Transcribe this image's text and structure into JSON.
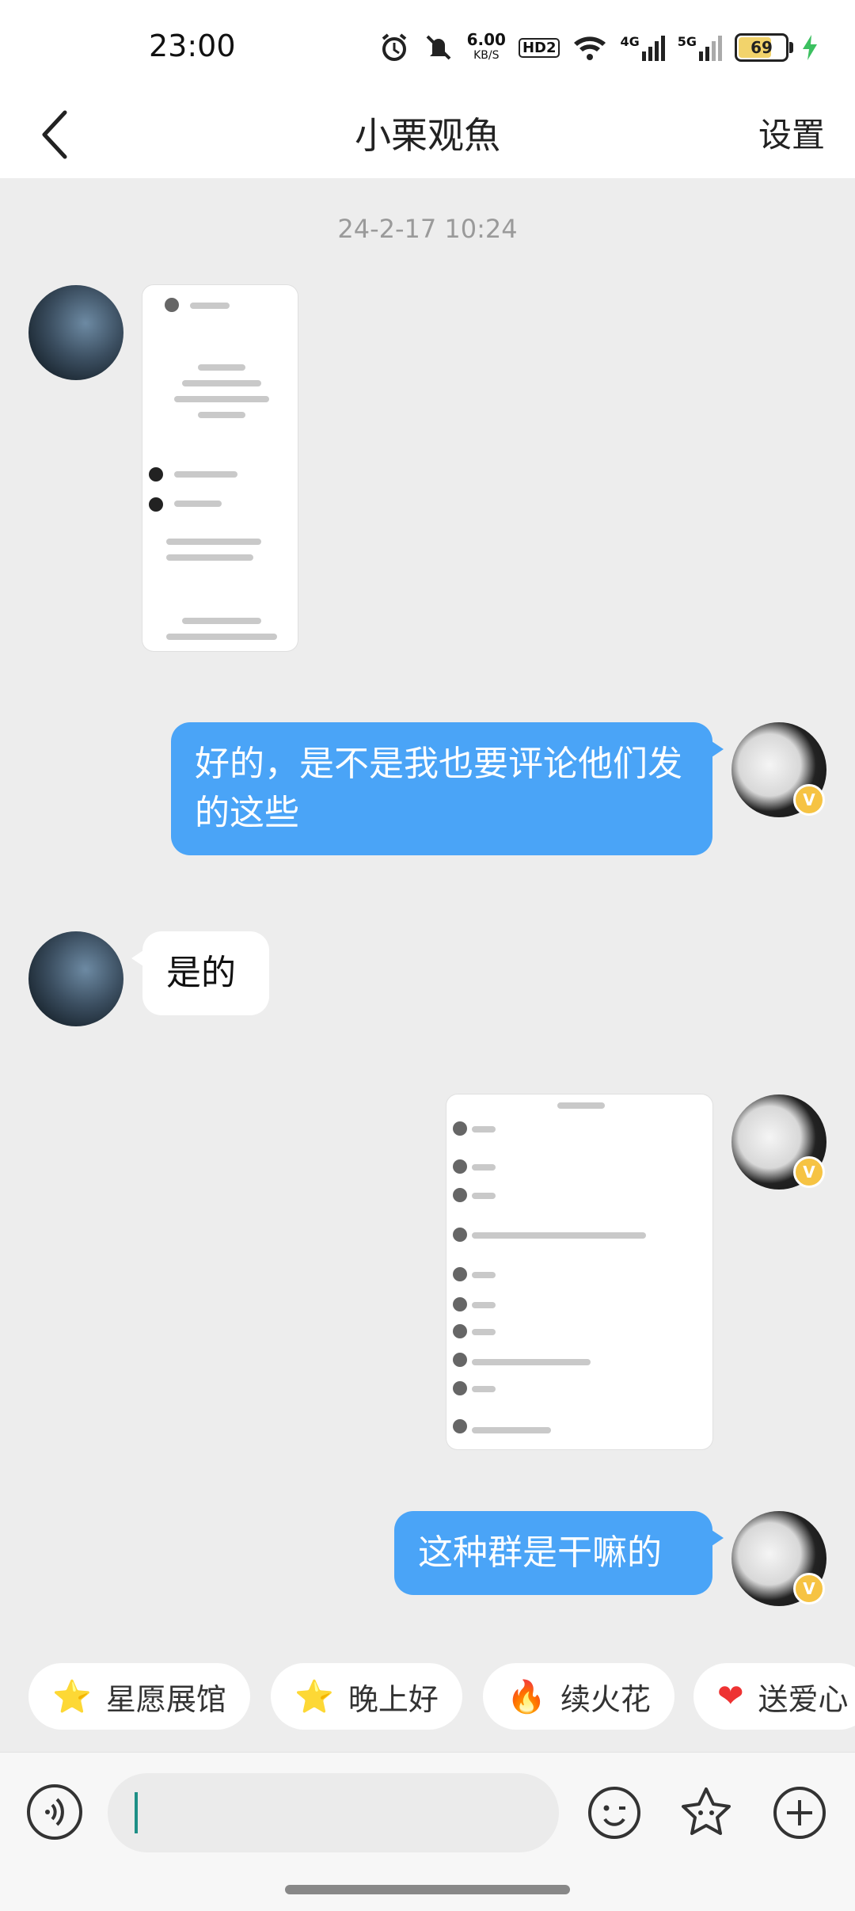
{
  "status": {
    "time": "23:00",
    "speed": "6.00",
    "speed_unit": "KB/S",
    "hd": "HD2",
    "net1": "4G",
    "net2": "5G",
    "battery": "69",
    "icons": [
      "alarm-icon",
      "mute-icon",
      "hd-icon",
      "wifi-icon",
      "signal-4g-icon",
      "signal-5g-icon",
      "battery-icon",
      "charging-icon"
    ]
  },
  "nav": {
    "title": "小栗观魚",
    "settings": "设置",
    "back_icon": "chevron-left-icon"
  },
  "chat": {
    "timestamp": "24-2-17 10:24",
    "messages": [
      {
        "from": "them",
        "type": "image"
      },
      {
        "from": "me",
        "type": "text",
        "text": "好的，是不是我也要评论他们发的这些"
      },
      {
        "from": "them",
        "type": "text",
        "text": "是的"
      },
      {
        "from": "me",
        "type": "image"
      },
      {
        "from": "me",
        "type": "text",
        "text": "这种群是干嘛的"
      }
    ]
  },
  "quick_actions": [
    {
      "icon": "star-emoji-icon",
      "label": "星愿展馆"
    },
    {
      "icon": "smile-star-icon",
      "label": "晚上好"
    },
    {
      "icon": "fire-icon",
      "label": "续火花"
    },
    {
      "icon": "heart-icon",
      "label": "送爱心"
    }
  ],
  "input": {
    "value": "",
    "icons": [
      "voice-icon",
      "emoji-icon",
      "sticker-icon",
      "plus-icon"
    ]
  },
  "colors": {
    "bubble_me": "#4aa4f7",
    "bubble_them": "#ffffff",
    "background": "#ededed"
  }
}
